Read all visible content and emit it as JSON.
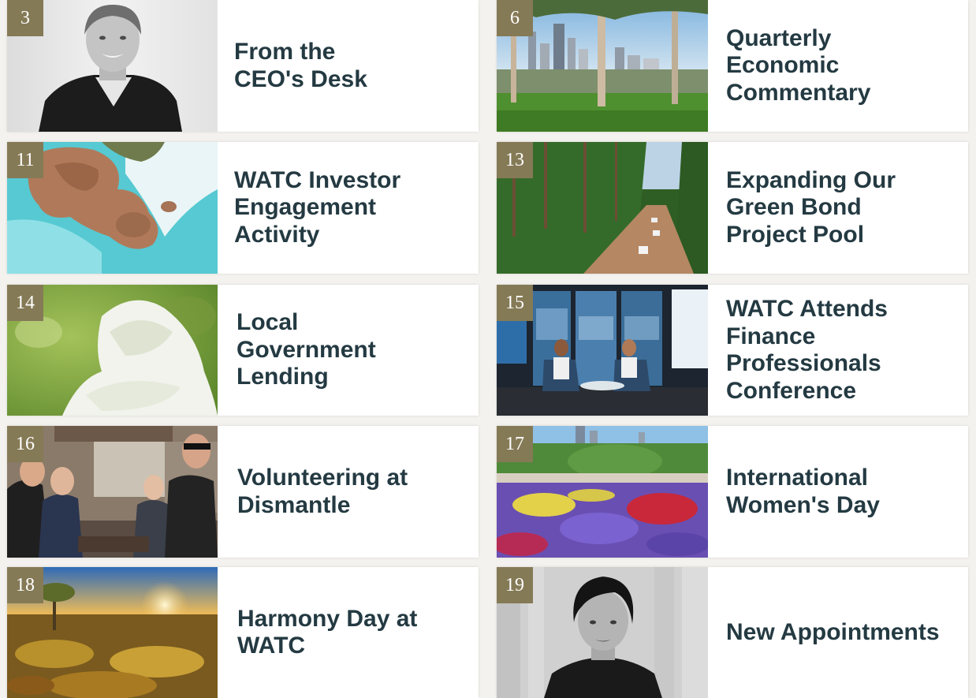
{
  "articles": [
    {
      "page": "3",
      "title": "From the CEO's Desk",
      "title_lines": [
        "From the",
        "CEO's Desk"
      ],
      "image": "portrait-ceo-photo"
    },
    {
      "page": "6",
      "title": "Quarterly Economic Commentary",
      "title_lines": [
        "Quarterly",
        "Economic",
        "Commentary"
      ],
      "image": "perth-skyline-photo"
    },
    {
      "page": "11",
      "title": "WATC Investor Engagement Activity",
      "title_lines": [
        "WATC Investor",
        "Engagement",
        "Activity"
      ],
      "image": "coastal-rocks-photo"
    },
    {
      "page": "13",
      "title": "Expanding Our Green Bond Project Pool",
      "title_lines": [
        "Expanding Our",
        "Green Bond",
        "Project Pool"
      ],
      "image": "forest-road-photo"
    },
    {
      "page": "14",
      "title": "Local Government Lending",
      "title_lines": [
        "Local",
        "Government",
        "Lending"
      ],
      "image": "wildflower-photo"
    },
    {
      "page": "15",
      "title": "WATC Attends Finance Professionals Conference",
      "title_lines": [
        "WATC Attends",
        "Finance",
        "Professionals",
        "Conference"
      ],
      "image": "conference-booth-photo"
    },
    {
      "page": "16",
      "title": "Volunteering at Dismantle",
      "title_lines": [
        "Volunteering at",
        "Dismantle"
      ],
      "image": "volunteers-workshop-photo"
    },
    {
      "page": "17",
      "title": "International Women's Day",
      "title_lines": [
        "International",
        "Women's Day"
      ],
      "image": "flower-garden-photo"
    },
    {
      "page": "18",
      "title": "Harmony Day at WATC",
      "title_lines": [
        "Harmony Day at",
        "WATC"
      ],
      "image": "outback-sunset-photo"
    },
    {
      "page": "19",
      "title": "New Appointments",
      "title_lines": [
        "New Appointments"
      ],
      "image": "portrait-appointee-photo"
    }
  ],
  "colors": {
    "badge": "#857a56",
    "title": "#243a42",
    "card": "#ffffff",
    "page_background": "#f4f2ee"
  }
}
